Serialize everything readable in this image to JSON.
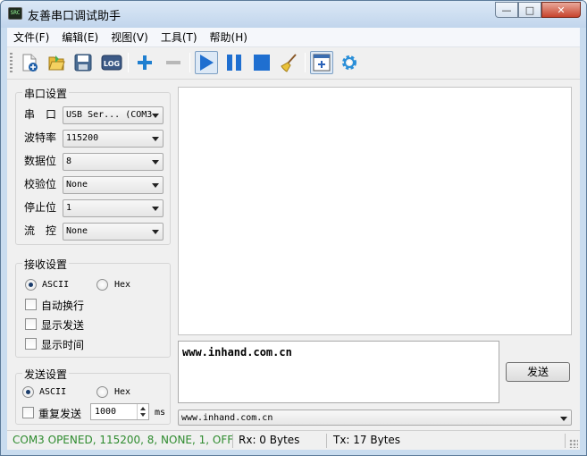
{
  "window": {
    "title": "友善串口调试助手",
    "icon_text": "SRC"
  },
  "menu": [
    "文件(F)",
    "编辑(E)",
    "视图(V)",
    "工具(T)",
    "帮助(H)"
  ],
  "toolbar_icons": [
    "new-icon",
    "open-icon",
    "save-icon",
    "log-icon",
    "plus-icon",
    "minus-icon",
    "play-icon",
    "pause-icon",
    "stop-icon",
    "broom-icon",
    "add-window-icon",
    "gear-icon"
  ],
  "serial": {
    "title": "串口设置",
    "port_label": "串　口",
    "port_value": "USB Ser... (COM3",
    "baud_label": "波特率",
    "baud_value": "115200",
    "data_label": "数据位",
    "data_value": "8",
    "parity_label": "校验位",
    "parity_value": "None",
    "stop_label": "停止位",
    "stop_value": "1",
    "flow_label": "流　控",
    "flow_value": "None"
  },
  "receive": {
    "title": "接收设置",
    "ascii": "ASCII",
    "hex": "Hex",
    "auto_wrap": "自动换行",
    "show_send": "显示发送",
    "show_time": "显示时间"
  },
  "send": {
    "title": "发送设置",
    "ascii": "ASCII",
    "hex": "Hex",
    "repeat": "重复发送",
    "interval": "1000",
    "unit": "ms",
    "text": "www.inhand.com.cn",
    "button": "发送",
    "history_value": "www.inhand.com.cn"
  },
  "status": {
    "state": "COM3 OPENED, 115200, 8, NONE, 1, OFF",
    "state_color": "#2e8b2e",
    "rx": "Rx: 0 Bytes",
    "tx": "Tx: 17 Bytes"
  }
}
